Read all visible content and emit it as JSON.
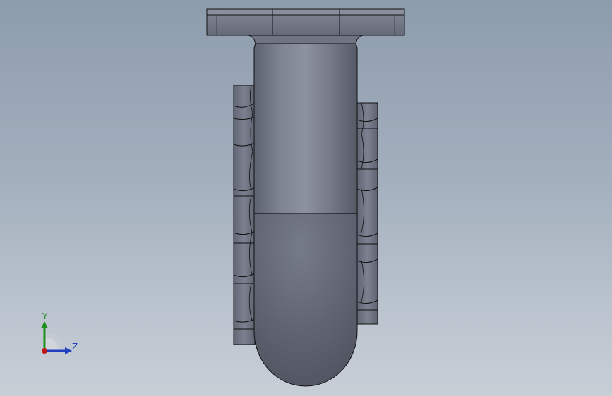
{
  "viewport": {
    "background_top": "#8d9cad",
    "background_bottom": "#c7ced6"
  },
  "model": {
    "part_color": "#7a7f8e",
    "edge_color": "#111111"
  },
  "triad": {
    "y_label": "Y",
    "z_label": "Z",
    "x_color": "#c01818",
    "y_color": "#1d8f1d",
    "z_color": "#1f3fbf"
  }
}
